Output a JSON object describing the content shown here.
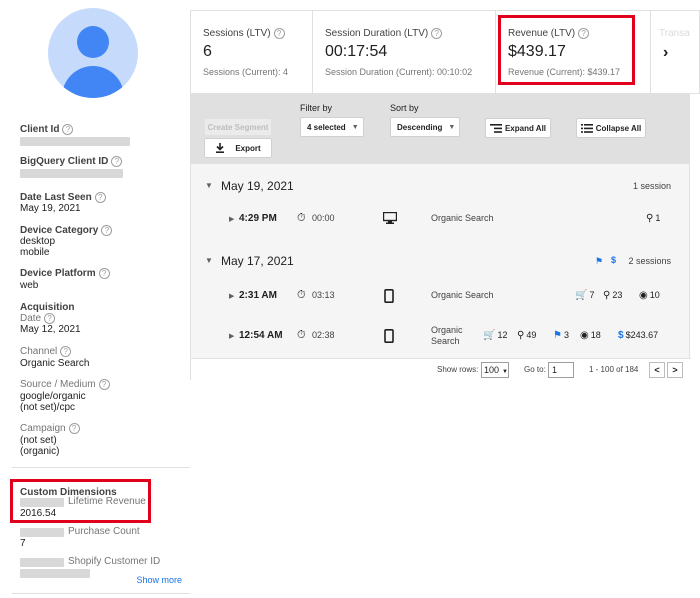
{
  "sidebar": {
    "client_id_label": "Client Id",
    "bigquery_label": "BigQuery Client ID",
    "date_last_seen_label": "Date Last Seen",
    "date_last_seen_value": "May 19, 2021",
    "device_category_label": "Device Category",
    "device_category_values": [
      "desktop",
      "mobile"
    ],
    "device_platform_label": "Device Platform",
    "device_platform_value": "web",
    "acquisition_label": "Acquisition",
    "date_label": "Date",
    "date_value": "May 12, 2021",
    "channel_label": "Channel",
    "channel_value": "Organic Search",
    "source_medium_label": "Source / Medium",
    "source_medium_values": [
      "google/organic",
      "(not set)/cpc"
    ],
    "campaign_label": "Campaign",
    "campaign_values": [
      "(not set)",
      "(organic)"
    ],
    "custom_dimensions_label": "Custom Dimensions",
    "lifetime_revenue_label": "Lifetime Revenue",
    "lifetime_revenue_value": "2016.54",
    "purchase_count_label": "Purchase Count",
    "purchase_count_value": "7",
    "shopify_label": "Shopify Customer ID",
    "show_more": "Show more",
    "help_glyph": "?"
  },
  "metrics": [
    {
      "label": "Sessions (LTV)",
      "value": "6",
      "sub": "Sessions (Current): 4"
    },
    {
      "label": "Session Duration (LTV)",
      "value": "00:17:54",
      "sub": "Session Duration (Current): 00:10:02"
    },
    {
      "label": "Revenue (LTV)",
      "value": "$439.17",
      "sub": "Revenue (Current): $439.17"
    }
  ],
  "metrics_next": {
    "faded_label": "Transa",
    "arrow": "›"
  },
  "toolbar": {
    "create_segment": "Create Segment",
    "export": "Export",
    "filter_label": "Filter by",
    "filter_value": "4 selected",
    "sort_label": "Sort by",
    "sort_value": "Descending",
    "expand_all": "Expand All",
    "collapse_all": "Collapse All"
  },
  "dates": [
    {
      "date": "May 19, 2021",
      "count": "1 session"
    },
    {
      "date": "May 17, 2021",
      "count": "2 sessions"
    }
  ],
  "sessions": [
    {
      "time": "4:29 PM",
      "duration": "00:00",
      "device": "desktop",
      "channel": "Organic Search",
      "goals": "1"
    },
    {
      "time": "2:31 AM",
      "duration": "03:13",
      "device": "mobile",
      "channel": "Organic Search",
      "cart": "7",
      "goals": "23",
      "views": "10"
    },
    {
      "time": "12:54 AM",
      "duration": "02:38",
      "device": "mobile",
      "channel_line1": "Organic",
      "channel_line2": "Search",
      "cart": "12",
      "goals": "49",
      "flags": "3",
      "views": "18",
      "revenue": "$243.67"
    }
  ],
  "footer": {
    "show_rows_label": "Show rows:",
    "show_rows_value": "100",
    "goto_label": "Go to:",
    "goto_value": "1",
    "range": "1 - 100 of 184",
    "prev": "<",
    "next": ">"
  },
  "colors": {
    "highlight": "#e0001b",
    "accent": "#1a73e8",
    "avatar": "#4285f4"
  }
}
